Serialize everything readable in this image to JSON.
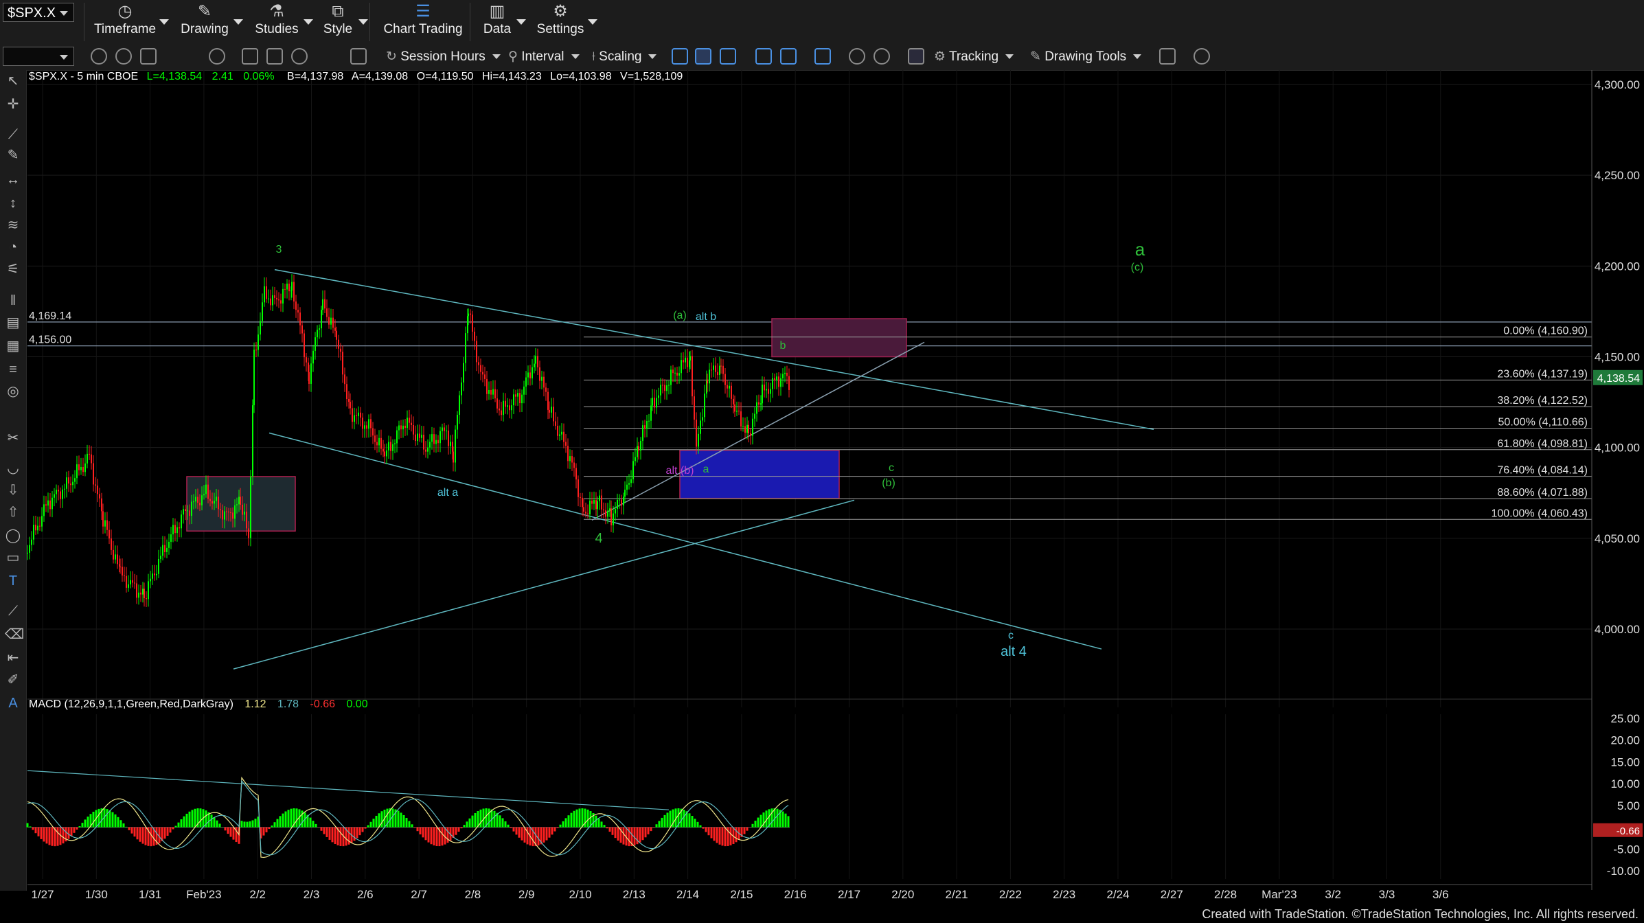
{
  "toolbar": {
    "symbol": "$SPX.X",
    "buttons": [
      {
        "label": "Timeframe",
        "icon": "clock-icon"
      },
      {
        "label": "Drawing",
        "icon": "pen-icon"
      },
      {
        "label": "Studies",
        "icon": "flask-icon"
      },
      {
        "label": "Style",
        "icon": "style-icon"
      },
      {
        "label": "Chart Trading",
        "icon": "chart-trading-icon"
      },
      {
        "label": "Data",
        "icon": "data-icon"
      },
      {
        "label": "Settings",
        "icon": "gear-icon"
      }
    ],
    "second_row": {
      "session_hours": "Session Hours",
      "interval": "Interval",
      "scaling": "Scaling",
      "tracking": "Tracking",
      "drawing_tools": "Drawing Tools"
    }
  },
  "header": {
    "title": "$SPX.X - 5 min  CBOE",
    "last": "L=4,138.54",
    "change": "2.41",
    "pct": "0.06%",
    "bid": "B=4,137.98",
    "ask": "A=4,139.08",
    "open": "O=4,119.50",
    "high": "Hi=4,143.23",
    "low": "Lo=4,103.98",
    "volume": "V=1,528,109"
  },
  "price_axis": {
    "labels": [
      "4,300.00",
      "4,250.00",
      "4,200.00",
      "4,150.00",
      "4,100.00",
      "4,050.00",
      "4,000.00"
    ],
    "current_price": "4,138.54"
  },
  "levels": [
    {
      "label": "4,169.14",
      "value": 4169.14
    },
    {
      "label": "4,156.00",
      "value": 4156.0
    }
  ],
  "fib": [
    {
      "label": "0.00% (4,160.90)",
      "value": 4160.9
    },
    {
      "label": "23.60% (4,137.19)",
      "value": 4137.19
    },
    {
      "label": "38.20% (4,122.52)",
      "value": 4122.52
    },
    {
      "label": "50.00% (4,110.66)",
      "value": 4110.66
    },
    {
      "label": "61.80% (4,098.81)",
      "value": 4098.81
    },
    {
      "label": "76.40% (4,084.14)",
      "value": 4084.14
    },
    {
      "label": "88.60% (4,071.88)",
      "value": 4071.88
    },
    {
      "label": "100.00% (4,060.43)",
      "value": 4060.43
    }
  ],
  "wave_labels": {
    "w3": "3",
    "w4": "4",
    "alt_a": "alt a",
    "wa_paren": "(a)",
    "alt_b": "alt b",
    "b": "b",
    "a_small": "a",
    "alt_b_paren": "alt (b)",
    "c": "c",
    "b_paren": "(b)",
    "big_a": "a",
    "c_paren": "(c)",
    "alt_c": "c",
    "alt_4": "alt 4"
  },
  "macd": {
    "title": "MACD (12,26,9,1,1,Green,Red,DarkGray)",
    "v1": "1.12",
    "v2": "1.78",
    "v3": "-0.66",
    "v4": "0.00",
    "axis": [
      "25.00",
      "20.00",
      "15.00",
      "10.00",
      "5.00",
      "-5.00",
      "-10.00"
    ],
    "current": "-0.66"
  },
  "date_axis": [
    "1/27",
    "1/30",
    "1/31",
    "Feb'23",
    "2/2",
    "2/3",
    "2/6",
    "2/7",
    "2/8",
    "2/9",
    "2/10",
    "2/13",
    "2/14",
    "2/15",
    "2/16",
    "2/17",
    "2/20",
    "2/21",
    "2/22",
    "2/23",
    "2/24",
    "2/27",
    "2/28",
    "Mar'23",
    "3/2",
    "3/3",
    "3/6"
  ],
  "footer": "Created with TradeStation. ©TradeStation Technologies, Inc. All rights reserved.",
  "colors": {
    "up": "#00ff00",
    "down": "#ff2020",
    "trend": "#5fb8c0",
    "wave_green": "#2fbf3a",
    "wave_cyan": "#4fc3d9",
    "magenta": "#c040d0",
    "box_blue": "#1a1ab0",
    "box_purple": "#4a1a3a"
  }
}
